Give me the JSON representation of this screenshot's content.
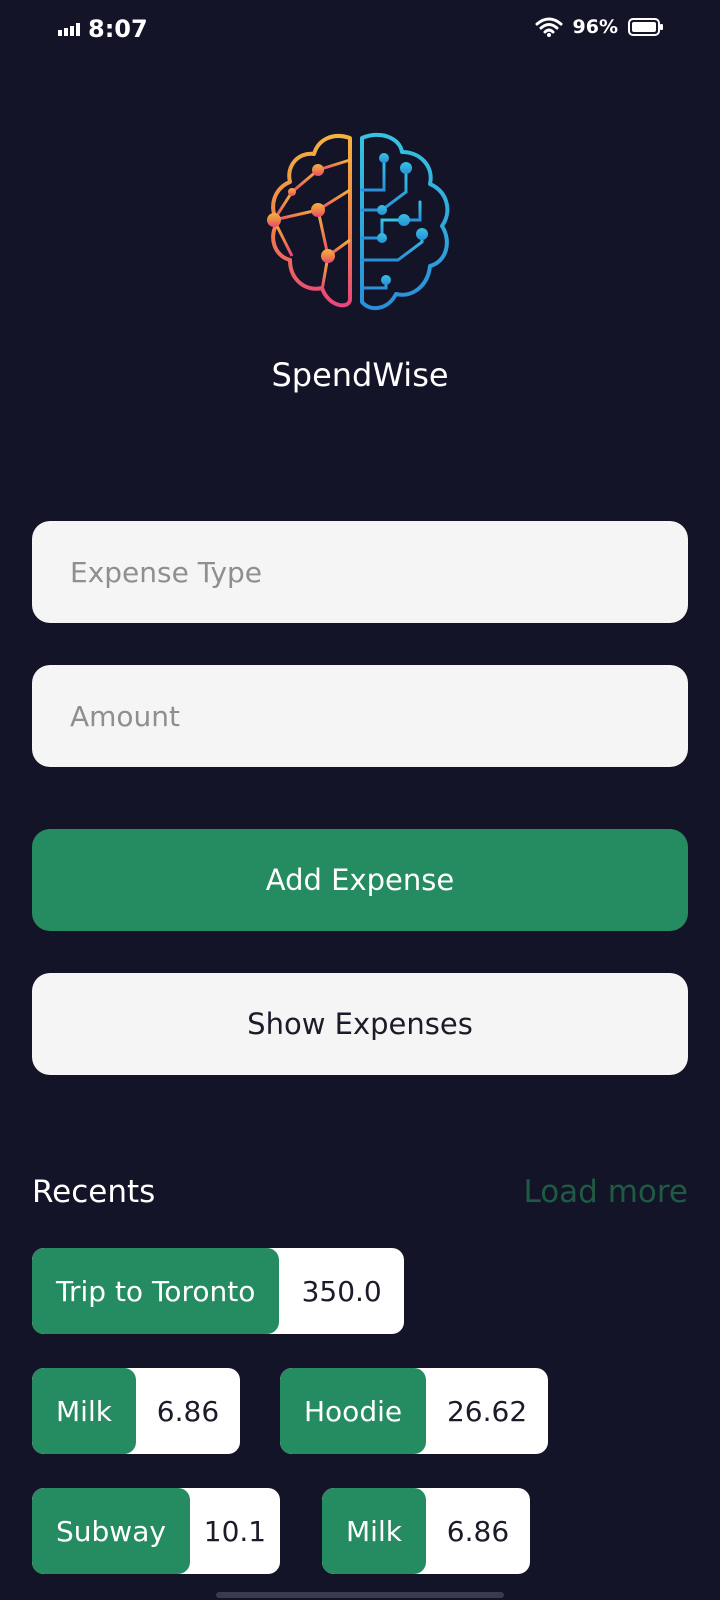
{
  "status_bar": {
    "time": "8:07",
    "battery": "96%",
    "icons": [
      "signal-icon",
      "wifi-icon",
      "battery-icon"
    ]
  },
  "app": {
    "title": "SpendWise",
    "logo_icon": "brain-circuit-logo-icon"
  },
  "form": {
    "expense_type_placeholder": "Expense Type",
    "expense_type_value": "",
    "amount_placeholder": "Amount",
    "amount_value": "",
    "add_label": "Add Expense",
    "show_label": "Show Expenses"
  },
  "recents": {
    "title": "Recents",
    "load_more": "Load more",
    "items": [
      {
        "label": "Trip to Toronto",
        "value": "350.0"
      },
      {
        "label": "Milk",
        "value": "6.86"
      },
      {
        "label": "Hoodie",
        "value": "26.62"
      },
      {
        "label": "Subway",
        "value": "10.1"
      },
      {
        "label": "Milk",
        "value": "6.86"
      }
    ]
  },
  "colors": {
    "background": "#131428",
    "accent_green": "#258c61",
    "field_background": "#f5f5f5",
    "load_more_text": "#1f5a43"
  }
}
